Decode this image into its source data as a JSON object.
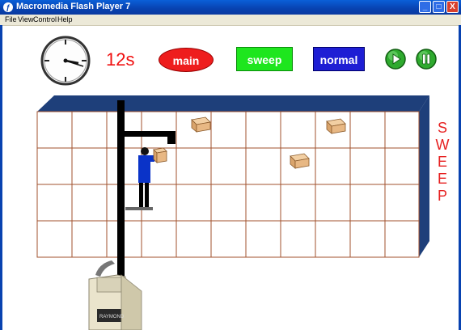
{
  "window": {
    "title": "Macromedia Flash Player 7",
    "buttons": {
      "minimize": "_",
      "maximize": "□",
      "close": "X"
    }
  },
  "menu": [
    "File",
    "View",
    "Control",
    "Help"
  ],
  "timer": {
    "label": "12s"
  },
  "modes": {
    "main": "main",
    "sweep": "sweep",
    "normal": "normal"
  },
  "controls": {
    "play": "play-icon",
    "pause": "pause-icon"
  },
  "side_label": [
    "S",
    "W",
    "E",
    "E",
    "P"
  ],
  "forklift": {
    "brand": "RAYMOND"
  },
  "colors": {
    "main": "#ee1d1d",
    "sweep": "#1ee61e",
    "normal": "#1e1ed4",
    "rack_top": "#1e3f7a",
    "grid_line": "#a0522d",
    "controls": "#2eaa2e"
  }
}
